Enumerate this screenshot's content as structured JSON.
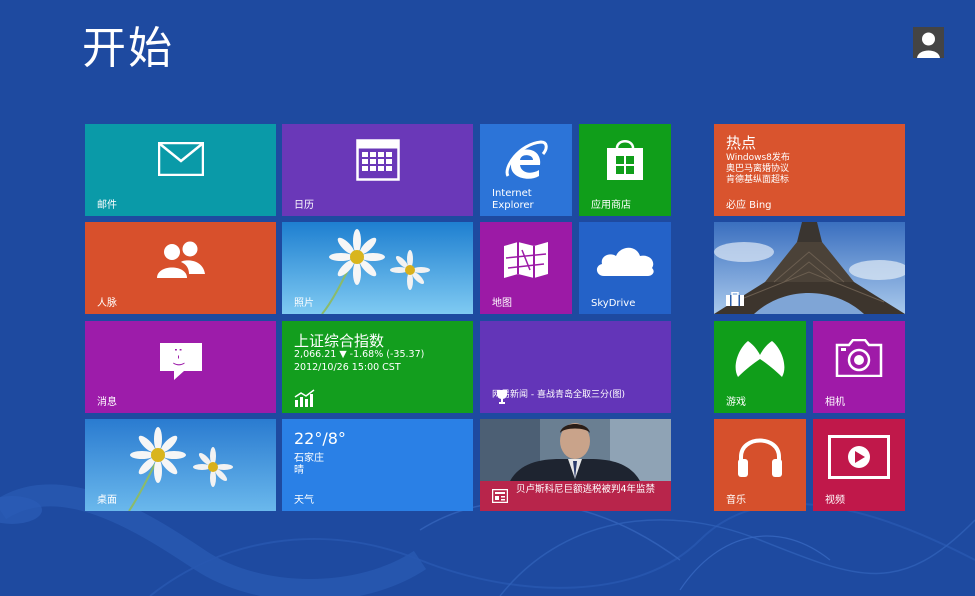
{
  "start": {
    "title": "开始"
  },
  "user": {
    "icon": "user-icon"
  },
  "colors": {
    "background": "#1e4aa0",
    "mail": "#0a9aa8",
    "calendar": "#6a38b8",
    "ie": "#2c74d8",
    "store": "#109e1a",
    "people": "#d8502c",
    "photos": "#3ea3e6",
    "maps": "#9c1aa6",
    "skydrive": "#2462c8",
    "messaging": "#9d1caa",
    "finance": "#139e1e",
    "sports": "#6335b8",
    "desktop": "#2b7fd5",
    "weather": "#2a80e6",
    "news": "#b8254b",
    "bing": "#d9542e",
    "travel": "#2c5ea8",
    "games": "#109e1a",
    "camera": "#9f1aa8",
    "music": "#d6502c",
    "video": "#c0184a"
  },
  "tiles": {
    "mail": {
      "label": "邮件",
      "icon": "mail-icon"
    },
    "calendar": {
      "label": "日历",
      "icon": "calendar-icon"
    },
    "ie": {
      "label_line1": "Internet",
      "label_line2": "Explorer",
      "icon": "ie-icon"
    },
    "store": {
      "label": "应用商店",
      "icon": "store-icon"
    },
    "people": {
      "label": "人脉",
      "icon": "people-icon"
    },
    "photos": {
      "label": "照片",
      "icon": "flower-photo"
    },
    "maps": {
      "label": "地图",
      "icon": "map-icon"
    },
    "skydrive": {
      "label": "SkyDrive",
      "icon": "cloud-icon"
    },
    "messaging": {
      "label": "消息",
      "icon": "message-icon"
    },
    "finance": {
      "title": "上证综合指数",
      "line1": "2,066.21  ▼ -1.68% (-35.37)",
      "line2": "2012/10/26 15:00 CST",
      "icon": "chart-icon"
    },
    "sports": {
      "text": "网易新闻 - 喜战青岛全取三分(图)",
      "icon": "trophy-icon"
    },
    "desktop": {
      "label": "桌面",
      "icon": "flower-photo"
    },
    "weather": {
      "temp": "22°/8°",
      "city": "石家庄",
      "condition": "晴",
      "label": "天气"
    },
    "news": {
      "text": "贝卢斯科尼巨额逃税被判4年监禁",
      "icon": "newspaper-icon"
    },
    "bing": {
      "title": "热点",
      "line1": "Windows8发布",
      "line2": "奥巴马离婚协议",
      "line3": "肯德基纵面超标",
      "label": "必应 Bing"
    },
    "travel": {
      "icon": "suitcase-icon"
    },
    "games": {
      "label": "游戏",
      "icon": "xbox-icon"
    },
    "camera": {
      "label": "相机",
      "icon": "camera-icon"
    },
    "music": {
      "label": "音乐",
      "icon": "headphones-icon"
    },
    "video": {
      "label": "视频",
      "icon": "play-icon"
    }
  }
}
